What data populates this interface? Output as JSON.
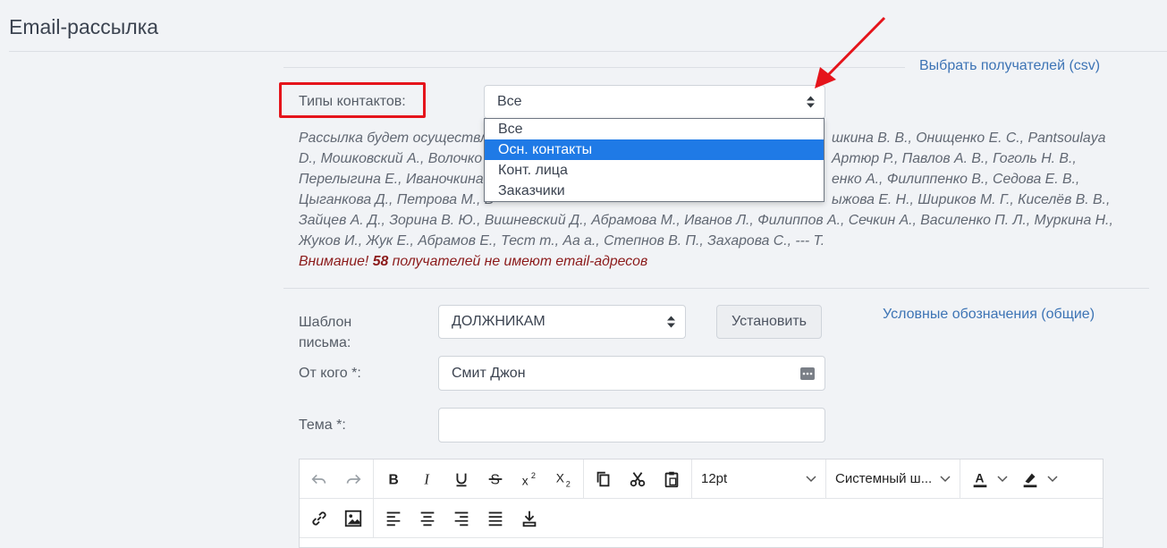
{
  "page": {
    "title": "Email-рассылка"
  },
  "recipients_link": "Выбрать получателей (csv)",
  "contact_types": {
    "label": "Типы контактов:",
    "selected": "Все",
    "options": [
      "Все",
      "Осн. контакты",
      "Конт. лица",
      "Заказчики"
    ],
    "highlighted_index": 1
  },
  "recipients": {
    "lines": [
      "Рассылка будет осуществле",
      "D., Мошковский А., Волочко",
      "Перелыгина Е., Иваночкина",
      "Цыганкова Д., Петрова М., В",
      "Зайцев А. Д., Зорина В. Ю., Вишневский Д., Абрамова М., Иванов Л., Филиппов А., Сечкин А., Василенко П. Л., Муркина Н.,",
      "Жуков И., Жук Е., Абрамов Е., Тест т., Аа а., Степнов В. П., Захарова С., --- Т."
    ],
    "lines_right": [
      "шкина В. В., Онищенко Е. С., Pantsoulaya",
      "Артюр Р., Павлов А. В., Гоголь Н. В.,",
      "енко А., Филиппенко В., Седова Е. В.,",
      "ыжова Е. Н., Шириков М. Г., Киселёв В. В.,"
    ],
    "warning_prefix": "Внимание!",
    "warning_count": "58",
    "warning_suffix": "получателей не имеют email-адресов"
  },
  "template": {
    "label": "Шаблон письма:",
    "selected": "ДОЛЖНИКАМ",
    "set_button": "Установить",
    "legend_link": "Условные обозначения (общие)"
  },
  "from": {
    "label": "От кого *:",
    "value": "Смит Джон"
  },
  "subject": {
    "label": "Тема *:",
    "value": ""
  },
  "editor": {
    "font_size": "12pt",
    "font_family": "Системный ш...",
    "tools_row1": [
      "undo-icon",
      "redo-icon",
      "bold-icon",
      "italic-icon",
      "underline-icon",
      "strikethrough-icon",
      "superscript-icon",
      "subscript-icon",
      "copy-icon",
      "cut-icon",
      "paste-icon",
      "text-color-icon",
      "highlight-color-icon"
    ],
    "tools_row2": [
      "link-icon",
      "image-icon",
      "align-left-icon",
      "align-center-icon",
      "align-right-icon",
      "align-justify-icon",
      "insert-file-icon"
    ]
  },
  "colors": {
    "accent": "#1f7ae6",
    "link": "#3d74b5",
    "annotation": "#e5141b",
    "warning": "#8b1a1a"
  }
}
